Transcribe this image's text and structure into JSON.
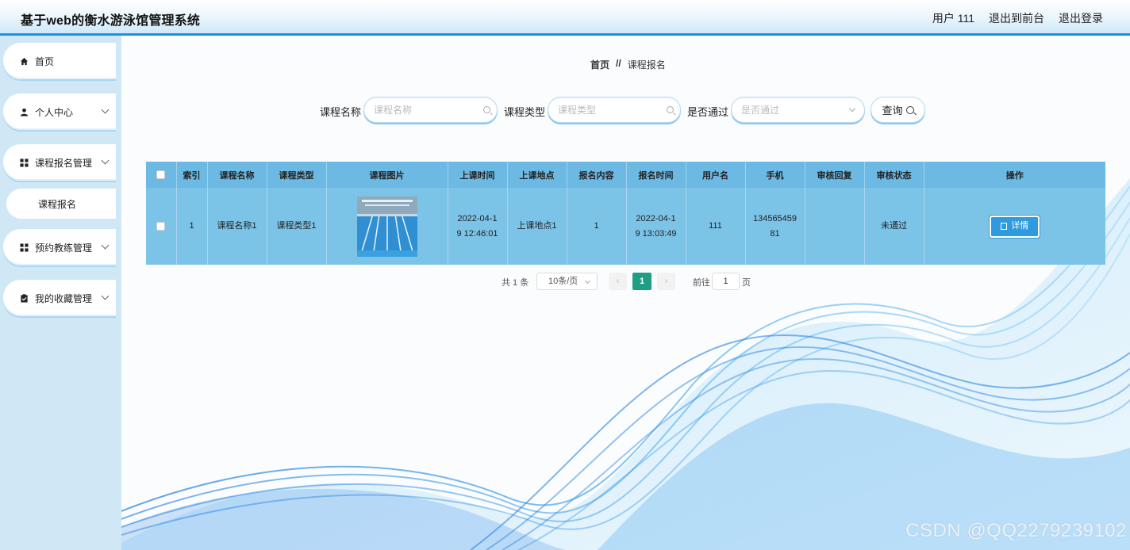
{
  "header": {
    "title": "基于web的衡水游泳馆管理系统",
    "user": "用户 111",
    "exit_front": "退出到前台",
    "logout": "退出登录"
  },
  "sidebar": {
    "items": [
      {
        "label": "首页",
        "icon": "home-icon"
      },
      {
        "label": "个人中心",
        "icon": "user-icon"
      },
      {
        "label": "课程报名管理",
        "icon": "grid-icon"
      },
      {
        "label": "预约教练管理",
        "icon": "grid-icon"
      },
      {
        "label": "我的收藏管理",
        "icon": "clipboard-icon"
      }
    ],
    "sub_item": "课程报名"
  },
  "breadcrumb": {
    "home": "首页",
    "sep": "//",
    "current": "课程报名"
  },
  "search": {
    "course_name_label": "课程名称",
    "course_name_placeholder": "课程名称",
    "course_type_label": "课程类型",
    "course_type_placeholder": "课程类型",
    "passed_label": "是否通过",
    "passed_placeholder": "是否通过",
    "query_label": "查询"
  },
  "table": {
    "headers": [
      "索引",
      "课程名称",
      "课程类型",
      "课程图片",
      "上课时间",
      "上课地点",
      "报名内容",
      "报名时间",
      "用户名",
      "手机",
      "审核回复",
      "审核状态",
      "操作"
    ],
    "rows": [
      {
        "index": "1",
        "course_name": "课程名称1",
        "course_type": "课程类型1",
        "class_time_a": "2022-04-1",
        "class_time_b": "9 12:46:01",
        "location": "上课地点1",
        "content": "1",
        "signup_time_a": "2022-04-1",
        "signup_time_b": "9 13:03:49",
        "username": "111",
        "phone_a": "134565459",
        "phone_b": "81",
        "reply": "",
        "status": "未通过",
        "action": "详情"
      }
    ]
  },
  "pager": {
    "total": "共 1 条",
    "page_size": "10条/页",
    "prev": "‹",
    "current": "1",
    "next": "›",
    "goto_label": "前往",
    "goto_value": "1",
    "page_unit": "页"
  },
  "watermark": "CSDN @QQ2279239102",
  "colors": {
    "accent": "#1e90e6",
    "table_header": "#6cb9e4",
    "table_row": "#7cc3e8",
    "page_active": "#1e9e85"
  }
}
